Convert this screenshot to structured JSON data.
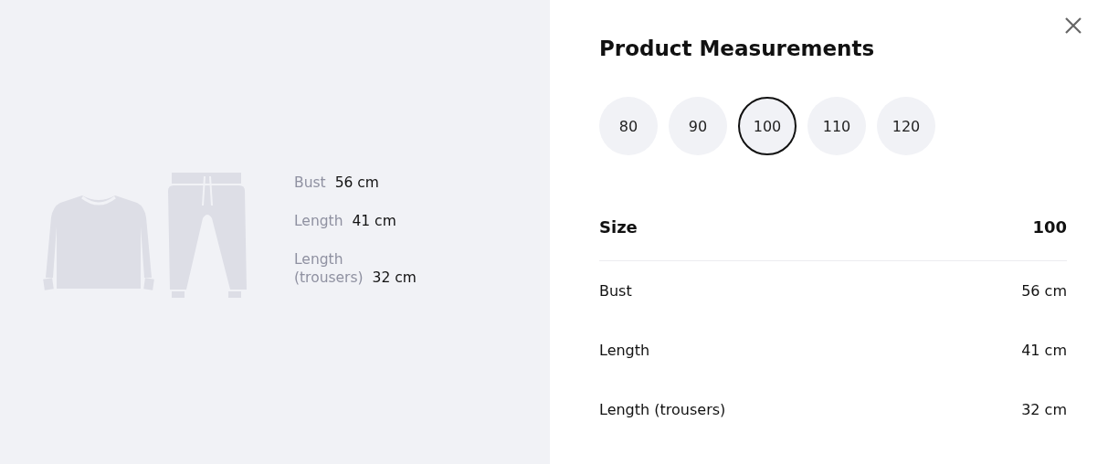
{
  "preview": {
    "measurements": [
      {
        "label": "Bust",
        "value": "56 cm"
      },
      {
        "label": "Length",
        "value": "41 cm"
      },
      {
        "label": "Length (trousers)",
        "value": "32 cm"
      }
    ]
  },
  "panel": {
    "title": "Product Measurements",
    "sizes": [
      {
        "label": "80",
        "selected": false
      },
      {
        "label": "90",
        "selected": false
      },
      {
        "label": "100",
        "selected": true
      },
      {
        "label": "110",
        "selected": false
      },
      {
        "label": "120",
        "selected": false
      }
    ],
    "table": {
      "header": {
        "label": "Size",
        "value": "100"
      },
      "rows": [
        {
          "label": "Bust",
          "value": "56 cm"
        },
        {
          "label": "Length",
          "value": "41 cm"
        },
        {
          "label": "Length (trousers)",
          "value": "32 cm"
        }
      ]
    }
  }
}
